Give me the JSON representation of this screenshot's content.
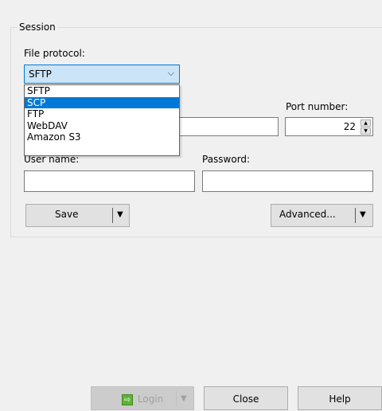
{
  "session": {
    "legend": "Session",
    "file_protocol_label": "File protocol:",
    "file_protocol_value": "SFTP",
    "protocol_options": [
      "SFTP",
      "SCP",
      "FTP",
      "WebDAV",
      "Amazon S3"
    ],
    "selected_option_index": 1,
    "port_label": "Port number:",
    "port_value": "22",
    "username_label": "User name:",
    "username_value": "",
    "password_label": "Password:",
    "password_value": "",
    "save_label": "Save",
    "advanced_label": "Advanced..."
  },
  "footer": {
    "login_label": "Login",
    "close_label": "Close",
    "help_label": "Help"
  },
  "icons": {
    "chevron": "chevron-down-icon",
    "split_caret": "caret-down-icon",
    "login": "login-icon",
    "spin_up": "spin-up-icon",
    "spin_down": "spin-down-icon"
  },
  "colors": {
    "accent": "#0078d7",
    "combo_bg": "#cce4f7",
    "window_bg": "#f0f0f0"
  }
}
